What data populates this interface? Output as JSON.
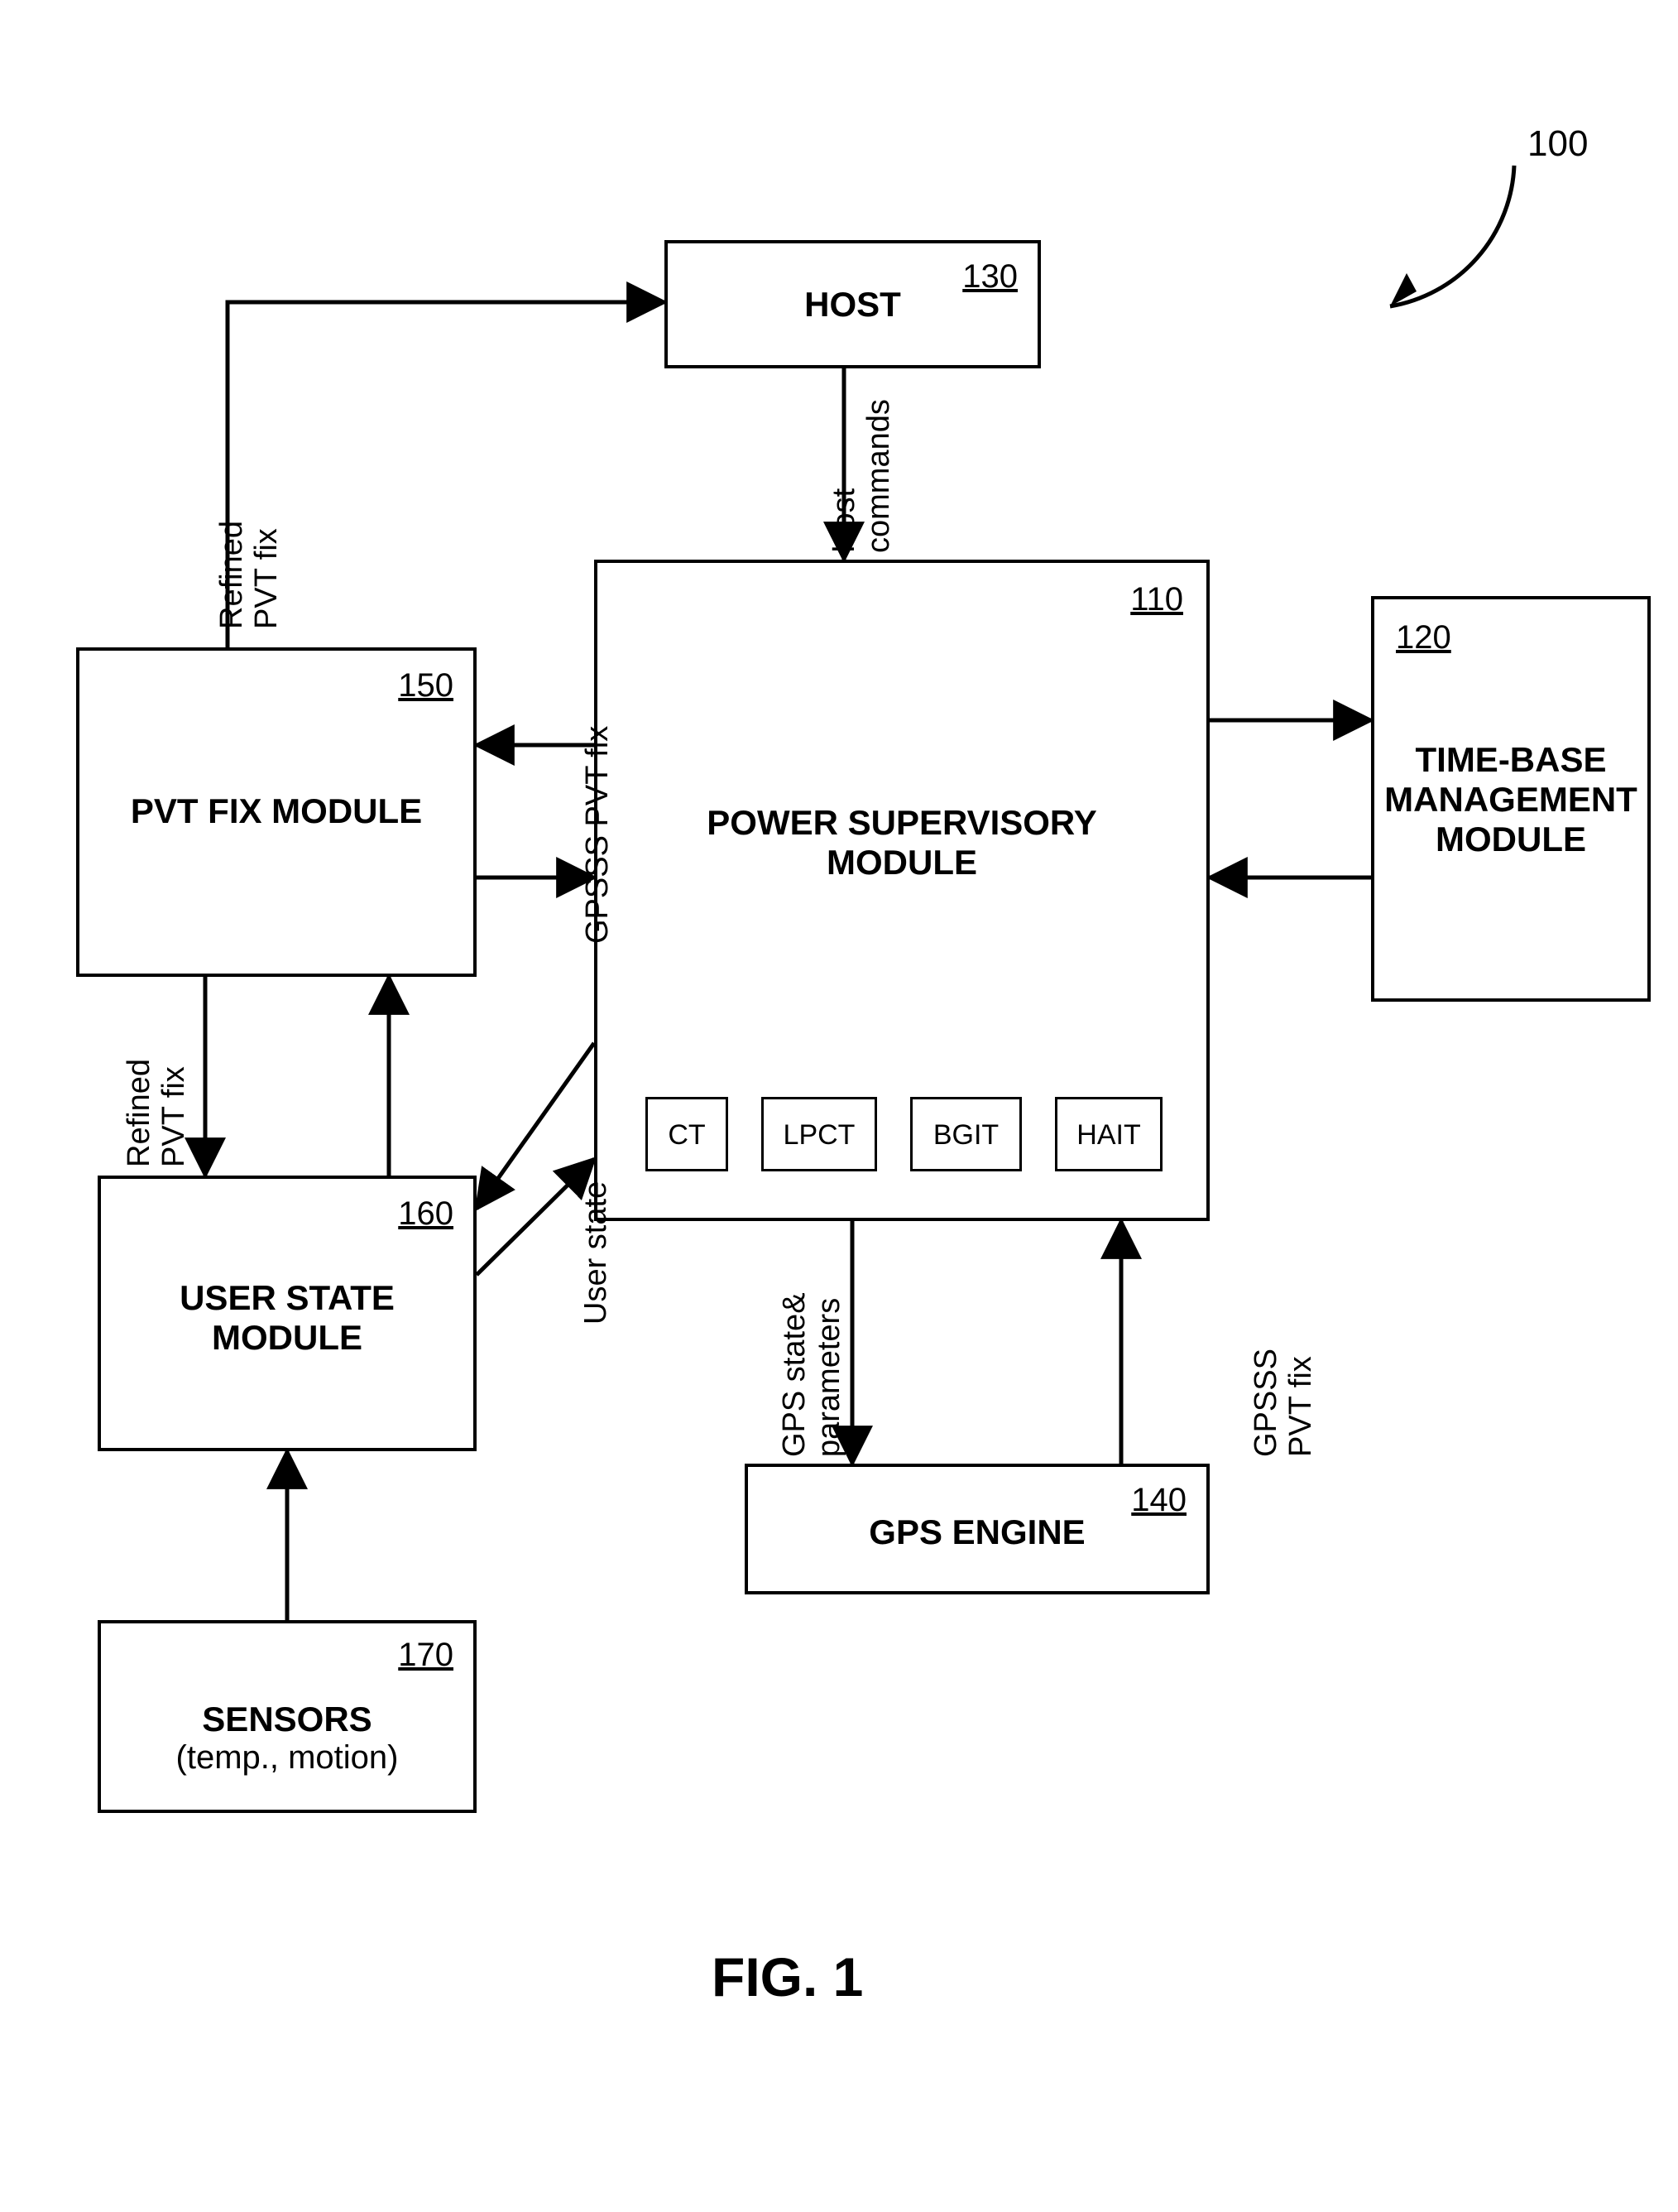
{
  "figure": {
    "caption": "FIG. 1",
    "system_ref": "100"
  },
  "boxes": {
    "host": {
      "title_lines": [
        "HOST"
      ],
      "num": "130"
    },
    "psm": {
      "title_lines": [
        "POWER SUPERVISORY",
        "MODULE"
      ],
      "num": "110"
    },
    "timebase": {
      "title_lines": [
        "TIME-BASE",
        "MANAGEMENT",
        "MODULE"
      ],
      "num": "120"
    },
    "pvtfix": {
      "title_lines": [
        "PVT FIX MODULE"
      ],
      "num": "150"
    },
    "userstate": {
      "title_lines": [
        "USER STATE",
        "MODULE"
      ],
      "num": "160"
    },
    "sensors": {
      "title_lines": [
        "SENSORS",
        "(temp., motion)"
      ],
      "num": "170"
    },
    "gps": {
      "title_lines": [
        "GPS ENGINE"
      ],
      "num": "140"
    }
  },
  "psm_modules": {
    "ct": "CT",
    "lpct": "LPCT",
    "bgit": "BGIT",
    "hait": "HAIT"
  },
  "arrows": {
    "host_to_psm": "Host\ncommands",
    "psm_to_pvtfix": "GPSSS PVT fix",
    "pvtfix_to_host": "Refined\nPVT fix",
    "pvtfix_to_userstate": "Refined\nPVT fix",
    "userstate_to_psm": "User state",
    "psm_to_gps": "GPS state&\nparameters",
    "gps_to_psm": "GPSSS\nPVT fix"
  }
}
